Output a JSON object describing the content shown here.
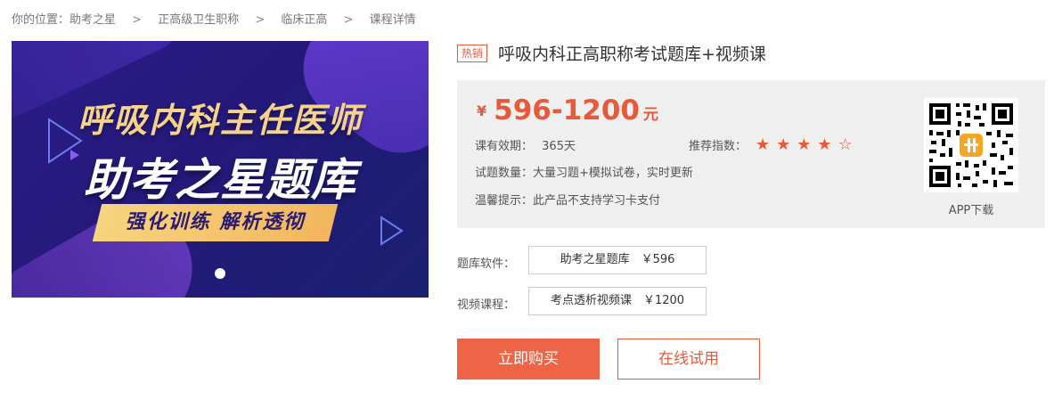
{
  "breadcrumb": {
    "prefix": "你的位置：",
    "items": [
      "助考之星",
      "正高级卫生职称",
      "临床正高",
      "课程详情"
    ],
    "separator": ">"
  },
  "banner": {
    "line1": "呼吸内科主任医师",
    "line2": "助考之星题库",
    "tag": "强化训练 解析透彻"
  },
  "product": {
    "badge": "热销",
    "title": "呼吸内科正高职称考试题库+视频课",
    "price_currency": "¥",
    "price_range": "596-1200",
    "price_unit": "元",
    "validity_label": "课有效期：",
    "validity_value": "365天",
    "rating_label": "推荐指数：",
    "rating_value": 4,
    "rating_max": 5,
    "questions_label": "试题数量：",
    "questions_value": "大量习题+模拟试卷，实时更新",
    "tip_label": "温馨提示：",
    "tip_value": "此产品不支持学习卡支付",
    "qr_label": "APP下载"
  },
  "options": {
    "software_label": "题库软件：",
    "software_option": "助考之星题库　￥596",
    "video_label": "视频课程：",
    "video_option": "考点透析视频课　￥1200"
  },
  "actions": {
    "buy_label": "立即购买",
    "try_label": "在线试用"
  },
  "colors": {
    "accent": "#e8593a",
    "button_bg": "#ee6446",
    "panel_bg": "#efefef",
    "banner_bg": "#24197a"
  }
}
